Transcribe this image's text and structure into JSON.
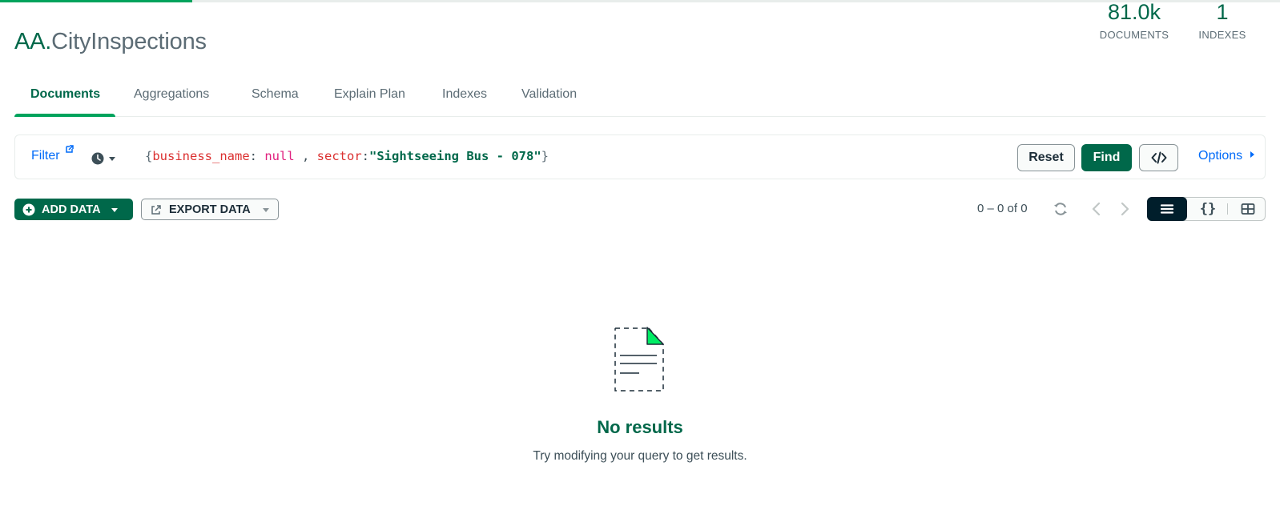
{
  "progress": {
    "fraction": 0.15,
    "color": "#00a35c"
  },
  "namespace": {
    "database": "AA",
    "separator": ".",
    "collection": "CityInspections"
  },
  "stats": {
    "documents": {
      "value": "81.0k",
      "label": "DOCUMENTS"
    },
    "indexes": {
      "value": "1",
      "label": "INDEXES"
    }
  },
  "tabs": [
    {
      "label": "Documents",
      "active": true
    },
    {
      "label": "Aggregations",
      "active": false
    },
    {
      "label": "Schema",
      "active": false
    },
    {
      "label": "Explain Plan",
      "active": false
    },
    {
      "label": "Indexes",
      "active": false
    },
    {
      "label": "Validation",
      "active": false
    }
  ],
  "querybar": {
    "filter_label": "Filter",
    "filter_icon": "external-link-icon",
    "history_icon": "clock-icon",
    "query": {
      "open_brace": "{",
      "key1": "business_name",
      "colon1": ": ",
      "value1": "null",
      "separator": " , ",
      "key2": "sector",
      "colon2": ":",
      "value2": "\"Sightseeing Bus - 078\"",
      "close_brace": "}"
    },
    "reset_label": "Reset",
    "find_label": "Find",
    "code_icon": "code-icon",
    "options_label": "Options"
  },
  "toolbar": {
    "add_data_label": "ADD DATA",
    "export_data_label": "EXPORT DATA",
    "pagination": "0 – 0 of 0",
    "refresh_icon": "refresh-icon",
    "prev_icon": "chevron-left-icon",
    "next_icon": "chevron-right-icon",
    "views": [
      {
        "name": "list-view",
        "icon": "list-icon",
        "active": true
      },
      {
        "name": "json-view",
        "icon": "braces-icon",
        "active": false
      },
      {
        "name": "table-view",
        "icon": "table-icon",
        "active": false
      }
    ]
  },
  "empty_state": {
    "icon": "empty-document-icon",
    "title": "No results",
    "subtitle": "Try modifying your query to get results."
  },
  "colors": {
    "brand_green": "#00684a",
    "accent_green": "#00a35c",
    "link_blue": "#016bf8",
    "dark": "#001e2b"
  }
}
